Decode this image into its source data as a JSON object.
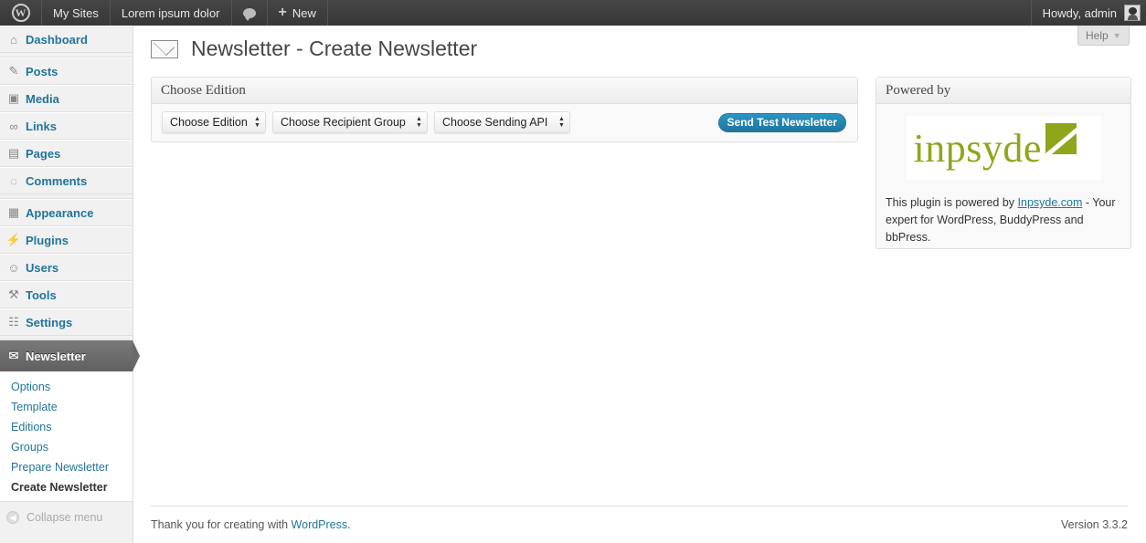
{
  "adminbar": {
    "my_sites": "My Sites",
    "site_name": "Lorem ipsum dolor",
    "new_label": "New",
    "greeting": "Howdy, admin"
  },
  "sidebar": {
    "items": [
      {
        "label": "Dashboard",
        "icon": "dashboard-icon"
      },
      {
        "label": "Posts",
        "icon": "pin-icon"
      },
      {
        "label": "Media",
        "icon": "media-icon"
      },
      {
        "label": "Links",
        "icon": "link-icon"
      },
      {
        "label": "Pages",
        "icon": "pages-icon"
      },
      {
        "label": "Comments",
        "icon": "comment-icon"
      },
      {
        "label": "Appearance",
        "icon": "appearance-icon"
      },
      {
        "label": "Plugins",
        "icon": "plug-icon"
      },
      {
        "label": "Users",
        "icon": "users-icon"
      },
      {
        "label": "Tools",
        "icon": "tools-icon"
      },
      {
        "label": "Settings",
        "icon": "settings-icon"
      }
    ],
    "active": {
      "label": "Newsletter",
      "icon": "envelope-icon"
    },
    "submenu": [
      "Options",
      "Template",
      "Editions",
      "Groups",
      "Prepare Newsletter",
      "Create Newsletter"
    ],
    "collapse_label": "Collapse menu"
  },
  "help_tab": "Help",
  "page_title": "Newsletter - Create Newsletter",
  "edition_box": {
    "title": "Choose Edition",
    "select_edition": "Choose Edition",
    "select_group": "Choose Recipient Group",
    "select_api": "Choose Sending API",
    "send_button": "Send Test Newsletter"
  },
  "powered_box": {
    "title": "Powered by",
    "logo_text": "inpsyde",
    "text_before": "This plugin is powered by ",
    "link_text": "Inpsyde.com",
    "text_after": " - Your expert for WordPress, BuddyPress and bbPress."
  },
  "footer": {
    "thanks_before": "Thank you for creating with ",
    "thanks_link": "WordPress",
    "thanks_after": ".",
    "version": "Version 3.3.2"
  },
  "colors": {
    "link": "#21759b",
    "adminbar": "#464646",
    "inpsyde_green": "#8fa61c"
  }
}
